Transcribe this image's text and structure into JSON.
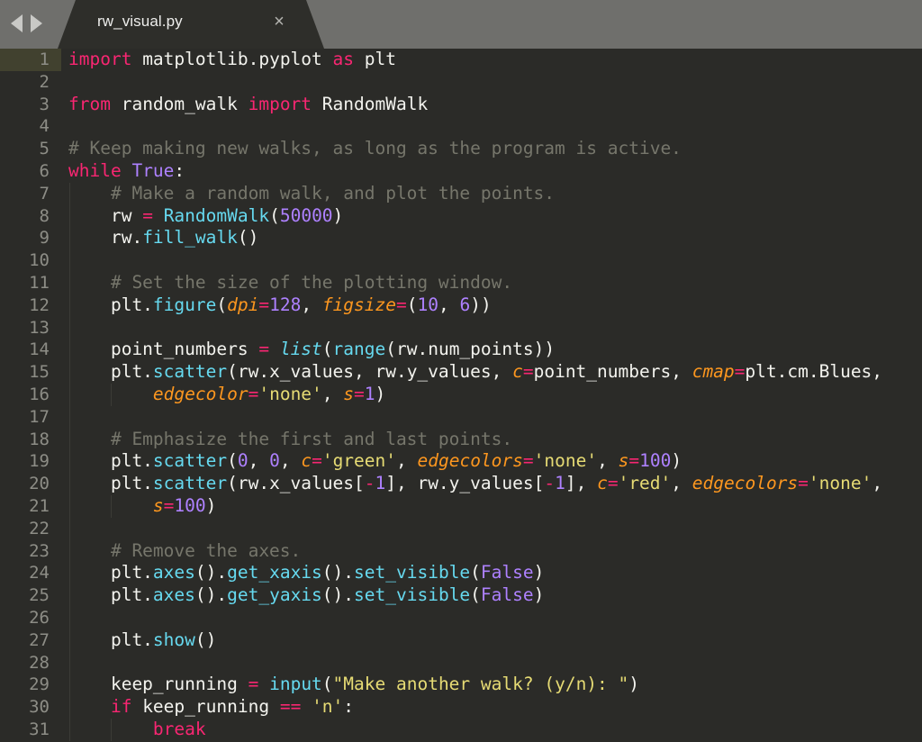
{
  "window": {
    "app_kind": "code-editor",
    "background": "#2b2b28",
    "tabbar_background": "#6f6f6c"
  },
  "tabbar": {
    "nav_back_icon": "triangle-left-icon",
    "nav_forward_icon": "triangle-right-icon",
    "tabs": [
      {
        "label": "rw_visual.py",
        "active": true,
        "close_label": "×"
      }
    ]
  },
  "editor": {
    "language": "Python",
    "active_line": 1,
    "first_visible_line": 1,
    "last_visible_line": 31,
    "colors": {
      "keyword": "#f92672",
      "comment": "#76766b",
      "function": "#66d9ef",
      "number": "#ae81ff",
      "string": "#e6db74",
      "parameter": "#fd971f",
      "text": "#f3f3ee",
      "active_line_gutter": "#41412f"
    },
    "lines": [
      {
        "n": 1,
        "indent": 0,
        "text": "import matplotlib.pyplot as plt"
      },
      {
        "n": 2,
        "indent": 0,
        "text": ""
      },
      {
        "n": 3,
        "indent": 0,
        "text": "from random_walk import RandomWalk"
      },
      {
        "n": 4,
        "indent": 0,
        "text": ""
      },
      {
        "n": 5,
        "indent": 0,
        "text": "# Keep making new walks, as long as the program is active."
      },
      {
        "n": 6,
        "indent": 0,
        "text": "while True:"
      },
      {
        "n": 7,
        "indent": 1,
        "text": "    # Make a random walk, and plot the points."
      },
      {
        "n": 8,
        "indent": 1,
        "text": "    rw = RandomWalk(50000)"
      },
      {
        "n": 9,
        "indent": 1,
        "text": "    rw.fill_walk()"
      },
      {
        "n": 10,
        "indent": 1,
        "text": ""
      },
      {
        "n": 11,
        "indent": 1,
        "text": "    # Set the size of the plotting window."
      },
      {
        "n": 12,
        "indent": 1,
        "text": "    plt.figure(dpi=128, figsize=(10, 6))"
      },
      {
        "n": 13,
        "indent": 1,
        "text": ""
      },
      {
        "n": 14,
        "indent": 1,
        "text": "    point_numbers = list(range(rw.num_points))"
      },
      {
        "n": 15,
        "indent": 1,
        "text": "    plt.scatter(rw.x_values, rw.y_values, c=point_numbers, cmap=plt.cm.Blues,"
      },
      {
        "n": 16,
        "indent": 2,
        "text": "        edgecolor='none', s=1)"
      },
      {
        "n": 17,
        "indent": 1,
        "text": ""
      },
      {
        "n": 18,
        "indent": 1,
        "text": "    # Emphasize the first and last points."
      },
      {
        "n": 19,
        "indent": 1,
        "text": "    plt.scatter(0, 0, c='green', edgecolors='none', s=100)"
      },
      {
        "n": 20,
        "indent": 1,
        "text": "    plt.scatter(rw.x_values[-1], rw.y_values[-1], c='red', edgecolors='none',"
      },
      {
        "n": 21,
        "indent": 2,
        "text": "        s=100)"
      },
      {
        "n": 22,
        "indent": 1,
        "text": ""
      },
      {
        "n": 23,
        "indent": 1,
        "text": "    # Remove the axes."
      },
      {
        "n": 24,
        "indent": 1,
        "text": "    plt.axes().get_xaxis().set_visible(False)"
      },
      {
        "n": 25,
        "indent": 1,
        "text": "    plt.axes().get_yaxis().set_visible(False)"
      },
      {
        "n": 26,
        "indent": 1,
        "text": ""
      },
      {
        "n": 27,
        "indent": 1,
        "text": "    plt.show()"
      },
      {
        "n": 28,
        "indent": 1,
        "text": ""
      },
      {
        "n": 29,
        "indent": 1,
        "text": "    keep_running = input(\"Make another walk? (y/n): \")"
      },
      {
        "n": 30,
        "indent": 1,
        "text": "    if keep_running == 'n':"
      },
      {
        "n": 31,
        "indent": 2,
        "text": "        break"
      }
    ],
    "tokens": [
      [
        [
          "kw",
          "import"
        ],
        [
          "pl",
          " matplotlib.pyplot "
        ],
        [
          "kw",
          "as"
        ],
        [
          "pl",
          " plt"
        ]
      ],
      [],
      [
        [
          "kw",
          "from"
        ],
        [
          "pl",
          " random_walk "
        ],
        [
          "kw",
          "import"
        ],
        [
          "pl",
          " RandomWalk"
        ]
      ],
      [],
      [
        [
          "com",
          "# Keep making new walks, as long as the program is active."
        ]
      ],
      [
        [
          "kw",
          "while"
        ],
        [
          "pl",
          " "
        ],
        [
          "num",
          "True"
        ],
        [
          "pl",
          ":"
        ]
      ],
      [
        [
          "com",
          "    # Make a random walk, and plot the points."
        ]
      ],
      [
        [
          "pl",
          "    rw "
        ],
        [
          "op",
          "="
        ],
        [
          "pl",
          " "
        ],
        [
          "fn",
          "RandomWalk"
        ],
        [
          "pl",
          "("
        ],
        [
          "num",
          "50000"
        ],
        [
          "pl",
          ")"
        ]
      ],
      [
        [
          "pl",
          "    rw."
        ],
        [
          "fn",
          "fill_walk"
        ],
        [
          "pl",
          "()"
        ]
      ],
      [],
      [
        [
          "com",
          "    # Set the size of the plotting window."
        ]
      ],
      [
        [
          "pl",
          "    plt."
        ],
        [
          "fn",
          "figure"
        ],
        [
          "pl",
          "("
        ],
        [
          "parn",
          "dpi"
        ],
        [
          "op",
          "="
        ],
        [
          "num",
          "128"
        ],
        [
          "pl",
          ", "
        ],
        [
          "parn",
          "figsize"
        ],
        [
          "op",
          "="
        ],
        [
          "pl",
          "("
        ],
        [
          "num",
          "10"
        ],
        [
          "pl",
          ", "
        ],
        [
          "num",
          "6"
        ],
        [
          "pl",
          "))"
        ]
      ],
      [],
      [
        [
          "pl",
          "    point_numbers "
        ],
        [
          "op",
          "="
        ],
        [
          "pl",
          " "
        ],
        [
          "bi",
          "list"
        ],
        [
          "pl",
          "("
        ],
        [
          "fn",
          "range"
        ],
        [
          "pl",
          "(rw.num_points))"
        ]
      ],
      [
        [
          "pl",
          "    plt."
        ],
        [
          "fn",
          "scatter"
        ],
        [
          "pl",
          "(rw.x_values, rw.y_values, "
        ],
        [
          "parn",
          "c"
        ],
        [
          "op",
          "="
        ],
        [
          "pl",
          "point_numbers, "
        ],
        [
          "parn",
          "cmap"
        ],
        [
          "op",
          "="
        ],
        [
          "pl",
          "plt.cm.Blues,"
        ]
      ],
      [
        [
          "pl",
          "        "
        ],
        [
          "parn",
          "edgecolor"
        ],
        [
          "op",
          "="
        ],
        [
          "str",
          "'none'"
        ],
        [
          "pl",
          ", "
        ],
        [
          "parn",
          "s"
        ],
        [
          "op",
          "="
        ],
        [
          "num",
          "1"
        ],
        [
          "pl",
          ")"
        ]
      ],
      [],
      [
        [
          "com",
          "    # Emphasize the first and last points."
        ]
      ],
      [
        [
          "pl",
          "    plt."
        ],
        [
          "fn",
          "scatter"
        ],
        [
          "pl",
          "("
        ],
        [
          "num",
          "0"
        ],
        [
          "pl",
          ", "
        ],
        [
          "num",
          "0"
        ],
        [
          "pl",
          ", "
        ],
        [
          "parn",
          "c"
        ],
        [
          "op",
          "="
        ],
        [
          "str",
          "'green'"
        ],
        [
          "pl",
          ", "
        ],
        [
          "parn",
          "edgecolors"
        ],
        [
          "op",
          "="
        ],
        [
          "str",
          "'none'"
        ],
        [
          "pl",
          ", "
        ],
        [
          "parn",
          "s"
        ],
        [
          "op",
          "="
        ],
        [
          "num",
          "100"
        ],
        [
          "pl",
          ")"
        ]
      ],
      [
        [
          "pl",
          "    plt."
        ],
        [
          "fn",
          "scatter"
        ],
        [
          "pl",
          "(rw.x_values["
        ],
        [
          "op",
          "-"
        ],
        [
          "num",
          "1"
        ],
        [
          "pl",
          "], rw.y_values["
        ],
        [
          "op",
          "-"
        ],
        [
          "num",
          "1"
        ],
        [
          "pl",
          "], "
        ],
        [
          "parn",
          "c"
        ],
        [
          "op",
          "="
        ],
        [
          "str",
          "'red'"
        ],
        [
          "pl",
          ", "
        ],
        [
          "parn",
          "edgecolors"
        ],
        [
          "op",
          "="
        ],
        [
          "str",
          "'none'"
        ],
        [
          "pl",
          ","
        ]
      ],
      [
        [
          "pl",
          "        "
        ],
        [
          "parn",
          "s"
        ],
        [
          "op",
          "="
        ],
        [
          "num",
          "100"
        ],
        [
          "pl",
          ")"
        ]
      ],
      [],
      [
        [
          "com",
          "    # Remove the axes."
        ]
      ],
      [
        [
          "pl",
          "    plt."
        ],
        [
          "fn",
          "axes"
        ],
        [
          "pl",
          "()."
        ],
        [
          "fn",
          "get_xaxis"
        ],
        [
          "pl",
          "()."
        ],
        [
          "fn",
          "set_visible"
        ],
        [
          "pl",
          "("
        ],
        [
          "num",
          "False"
        ],
        [
          "pl",
          ")"
        ]
      ],
      [
        [
          "pl",
          "    plt."
        ],
        [
          "fn",
          "axes"
        ],
        [
          "pl",
          "()."
        ],
        [
          "fn",
          "get_yaxis"
        ],
        [
          "pl",
          "()."
        ],
        [
          "fn",
          "set_visible"
        ],
        [
          "pl",
          "("
        ],
        [
          "num",
          "False"
        ],
        [
          "pl",
          ")"
        ]
      ],
      [],
      [
        [
          "pl",
          "    plt."
        ],
        [
          "fn",
          "show"
        ],
        [
          "pl",
          "()"
        ]
      ],
      [],
      [
        [
          "pl",
          "    keep_running "
        ],
        [
          "op",
          "="
        ],
        [
          "pl",
          " "
        ],
        [
          "fn",
          "input"
        ],
        [
          "pl",
          "("
        ],
        [
          "str",
          "\"Make another walk? (y/n): \""
        ],
        [
          "pl",
          ")"
        ]
      ],
      [
        [
          "pl",
          "    "
        ],
        [
          "kw",
          "if"
        ],
        [
          "pl",
          " keep_running "
        ],
        [
          "op",
          "=="
        ],
        [
          "pl",
          " "
        ],
        [
          "str",
          "'n'"
        ],
        [
          "pl",
          ":"
        ]
      ],
      [
        [
          "pl",
          "        "
        ],
        [
          "kw",
          "break"
        ]
      ]
    ]
  }
}
